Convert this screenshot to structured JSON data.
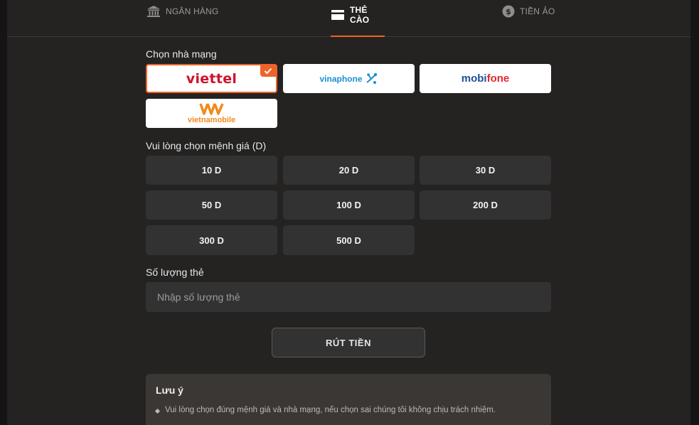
{
  "tabs": [
    {
      "label": "NGÂN HÀNG",
      "icon": "bank-icon",
      "active": false
    },
    {
      "label": "THẺ CÀO",
      "icon": "card-icon",
      "active": true
    },
    {
      "label": "TIỀN ẢO",
      "icon": "coin-icon",
      "active": false
    }
  ],
  "carrier_section": {
    "label": "Chọn nhà mạng",
    "carriers": [
      {
        "name": "viettel",
        "selected": true
      },
      {
        "name": "vinaphone",
        "selected": false
      },
      {
        "name_a": "mobi",
        "name_b": "fone",
        "selected": false
      },
      {
        "name": "vietnamobile",
        "selected": false
      }
    ]
  },
  "denomination_section": {
    "label": "Vui lòng chọn mệnh giá (D)",
    "options": [
      "10 D",
      "20 D",
      "30 D",
      "50 D",
      "100 D",
      "200 D",
      "300 D",
      "500 D"
    ]
  },
  "quantity_section": {
    "label": "Số lượng thẻ",
    "placeholder": "Nhập số lượng thẻ",
    "value": ""
  },
  "withdraw_button": {
    "label": "RÚT TIỀN"
  },
  "note": {
    "title": "Lưu ý",
    "items": [
      "Vui lòng chọn đúng mệnh giá và nhà mạng, nếu chọn sai chúng tôi không chịu trách nhiệm."
    ]
  },
  "colors": {
    "accent": "#f0622a",
    "panel": "#242322",
    "tile": "#333232",
    "viettel": "#d0112b",
    "vinaphone": "#1a8fd3",
    "mobifone_blue": "#1d4f9a",
    "mobifone_red": "#e3262d",
    "vietnamobile": "#f08a1c"
  }
}
